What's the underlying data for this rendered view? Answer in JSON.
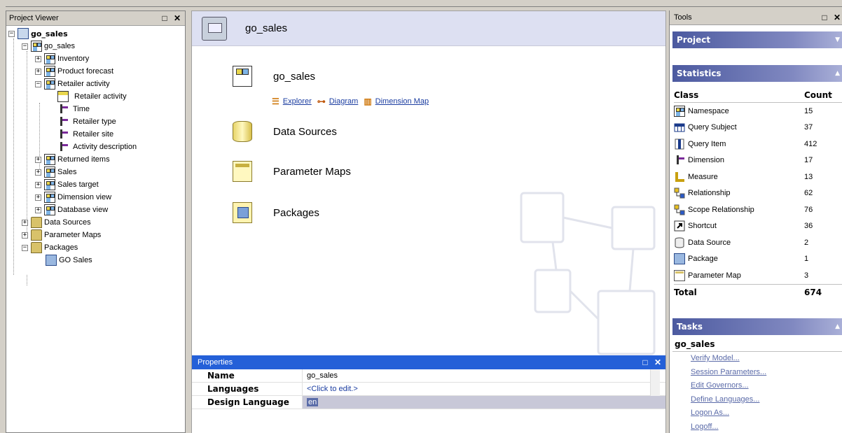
{
  "project_viewer": {
    "title": "Project Viewer",
    "root": "go_sales",
    "items": [
      {
        "label": "go_sales",
        "icon": "namespace-icon"
      },
      {
        "label": "Inventory",
        "icon": "namespace-icon"
      },
      {
        "label": "Product forecast",
        "icon": "namespace-icon"
      },
      {
        "label": "Retailer activity",
        "icon": "namespace-icon"
      },
      {
        "label": "Retailer activity",
        "icon": "query-subject-icon"
      },
      {
        "label": "Time",
        "icon": "dimension-icon"
      },
      {
        "label": "Retailer type",
        "icon": "dimension-icon"
      },
      {
        "label": "Retailer site",
        "icon": "dimension-icon"
      },
      {
        "label": "Activity description",
        "icon": "dimension-icon"
      },
      {
        "label": "Returned items",
        "icon": "namespace-icon"
      },
      {
        "label": "Sales",
        "icon": "namespace-icon"
      },
      {
        "label": "Sales target",
        "icon": "namespace-icon"
      },
      {
        "label": "Dimension view",
        "icon": "namespace-icon"
      },
      {
        "label": "Database view",
        "icon": "namespace-icon"
      },
      {
        "label": "Data Sources",
        "icon": "data-sources-folder-icon"
      },
      {
        "label": "Parameter Maps",
        "icon": "parameter-maps-folder-icon"
      },
      {
        "label": "Packages",
        "icon": "packages-folder-icon"
      },
      {
        "label": "GO Sales",
        "icon": "package-icon"
      }
    ]
  },
  "main": {
    "header_title": "go_sales",
    "namespace_title": "go_sales",
    "links": [
      "Explorer",
      "Diagram",
      "Dimension Map"
    ],
    "sections": [
      "Data Sources",
      "Parameter Maps",
      "Packages"
    ]
  },
  "properties": {
    "title": "Properties",
    "rows": [
      {
        "key": "Name",
        "value": "go_sales"
      },
      {
        "key": "Languages",
        "value": "<Click to edit.>"
      },
      {
        "key": "Design Language",
        "value": "en"
      }
    ]
  },
  "tools": {
    "title": "Tools",
    "project_panel": "Project",
    "statistics_panel": "Statistics",
    "stats_headers": {
      "class": "Class",
      "count": "Count"
    },
    "stats": [
      {
        "label": "Namespace",
        "count": "15",
        "icon": "namespace-icon"
      },
      {
        "label": "Query Subject",
        "count": "37",
        "icon": "query-subject-icon"
      },
      {
        "label": "Query Item",
        "count": "412",
        "icon": "query-item-icon"
      },
      {
        "label": "Dimension",
        "count": "17",
        "icon": "dimension-icon"
      },
      {
        "label": "Measure",
        "count": "13",
        "icon": "measure-icon"
      },
      {
        "label": "Relationship",
        "count": "62",
        "icon": "relationship-icon"
      },
      {
        "label": "Scope Relationship",
        "count": "76",
        "icon": "scope-relationship-icon"
      },
      {
        "label": "Shortcut",
        "count": "36",
        "icon": "shortcut-icon"
      },
      {
        "label": "Data Source",
        "count": "2",
        "icon": "data-source-icon"
      },
      {
        "label": "Package",
        "count": "1",
        "icon": "package-icon"
      },
      {
        "label": "Parameter Map",
        "count": "3",
        "icon": "parameter-map-icon"
      }
    ],
    "total_label": "Total",
    "total_count": "674",
    "tasks_panel": "Tasks",
    "tasks_object": "go_sales",
    "tasks": [
      "Verify Model...",
      "Session Parameters...",
      "Edit Governors...",
      "Define Languages...",
      "Logon As...",
      "Logoff..."
    ]
  }
}
